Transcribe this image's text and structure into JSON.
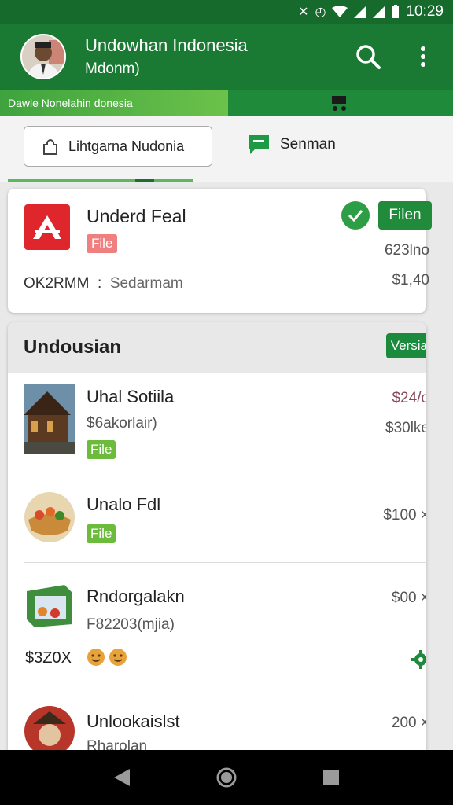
{
  "status_bar": {
    "time": "10:29"
  },
  "app_bar": {
    "title": "Undowhan Indonesia",
    "subtitle": "Mdonm)"
  },
  "banner": {
    "text": "Dawle Nonelahin donesia"
  },
  "tabs": {
    "first": "Lihtgarna Nudonia",
    "second": "Senman"
  },
  "featured": {
    "name": "Underd Feal",
    "tag": "File",
    "action": "Filen",
    "meta": "623lno",
    "code": "OK2RMM",
    "separator": ":",
    "seller": "Sedarmam",
    "price": "$1,40"
  },
  "section": {
    "title": "Undousian",
    "action": "Versia",
    "items": [
      {
        "name": "Uhal Sotiila",
        "sub": "$6akorlair)",
        "tag": "File",
        "price1": "$24/o",
        "price2": "$30lke"
      },
      {
        "name": "Unalo Fdl",
        "tag": "File",
        "price1": "$100 ×"
      },
      {
        "name": "Rndorgalakn",
        "sub": "F82203(mjia)",
        "price1": "$00 ×",
        "price2": "$3Z0X"
      },
      {
        "name": "Unlookaislst",
        "sub": "Rharolan",
        "price1": "200 ×"
      }
    ]
  },
  "colors": {
    "primary": "#1a7a33",
    "status": "#166b2c",
    "accent_green": "#6cbb3c",
    "red_tag": "#f08080"
  }
}
